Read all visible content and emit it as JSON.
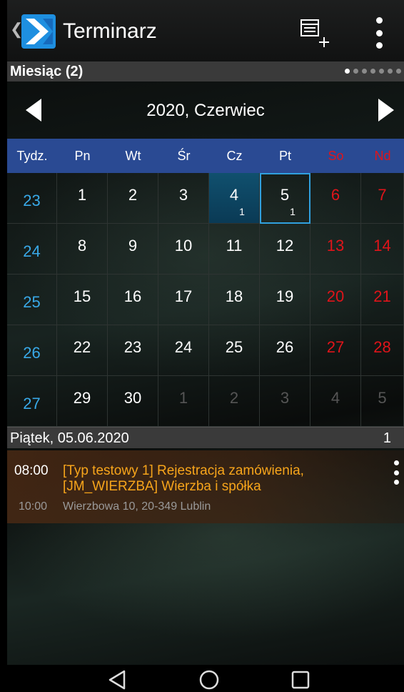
{
  "app": {
    "title": "Terminarz"
  },
  "subbar": {
    "title": "Miesiąc (2)",
    "pages": 7,
    "active_page": 0
  },
  "monthnav": {
    "label": "2020, Czerwiec"
  },
  "weekdays": {
    "week": "Tydz.",
    "d": [
      "Pn",
      "Wt",
      "Śr",
      "Cz",
      "Pt",
      "So",
      "Nd"
    ]
  },
  "colors": {
    "accent": "#39a9e8",
    "weekend": "#e0141a",
    "event": "#f7a51b",
    "header": "#2a4a93"
  },
  "calendar": {
    "weeks": [
      {
        "week": "23",
        "days": [
          {
            "n": "1",
            "other": false,
            "count": ""
          },
          {
            "n": "2",
            "other": false,
            "count": ""
          },
          {
            "n": "3",
            "other": false,
            "count": ""
          },
          {
            "n": "4",
            "other": false,
            "count": "1",
            "today": true
          },
          {
            "n": "5",
            "other": false,
            "count": "1",
            "selected": true
          },
          {
            "n": "6",
            "other": false,
            "count": ""
          },
          {
            "n": "7",
            "other": false,
            "count": ""
          }
        ]
      },
      {
        "week": "24",
        "days": [
          {
            "n": "8",
            "other": false,
            "count": ""
          },
          {
            "n": "9",
            "other": false,
            "count": ""
          },
          {
            "n": "10",
            "other": false,
            "count": ""
          },
          {
            "n": "11",
            "other": false,
            "count": ""
          },
          {
            "n": "12",
            "other": false,
            "count": ""
          },
          {
            "n": "13",
            "other": false,
            "count": ""
          },
          {
            "n": "14",
            "other": false,
            "count": ""
          }
        ]
      },
      {
        "week": "25",
        "days": [
          {
            "n": "15",
            "other": false,
            "count": ""
          },
          {
            "n": "16",
            "other": false,
            "count": ""
          },
          {
            "n": "17",
            "other": false,
            "count": ""
          },
          {
            "n": "18",
            "other": false,
            "count": ""
          },
          {
            "n": "19",
            "other": false,
            "count": ""
          },
          {
            "n": "20",
            "other": false,
            "count": ""
          },
          {
            "n": "21",
            "other": false,
            "count": ""
          }
        ]
      },
      {
        "week": "26",
        "days": [
          {
            "n": "22",
            "other": false,
            "count": ""
          },
          {
            "n": "23",
            "other": false,
            "count": ""
          },
          {
            "n": "24",
            "other": false,
            "count": ""
          },
          {
            "n": "25",
            "other": false,
            "count": ""
          },
          {
            "n": "26",
            "other": false,
            "count": ""
          },
          {
            "n": "27",
            "other": false,
            "count": ""
          },
          {
            "n": "28",
            "other": false,
            "count": ""
          }
        ]
      },
      {
        "week": "27",
        "days": [
          {
            "n": "29",
            "other": false,
            "count": ""
          },
          {
            "n": "30",
            "other": false,
            "count": ""
          },
          {
            "n": "1",
            "other": true,
            "count": ""
          },
          {
            "n": "2",
            "other": true,
            "count": ""
          },
          {
            "n": "3",
            "other": true,
            "count": ""
          },
          {
            "n": "4",
            "other": true,
            "count": ""
          },
          {
            "n": "5",
            "other": true,
            "count": ""
          }
        ]
      }
    ]
  },
  "day": {
    "title": "Piątek, 05.06.2020",
    "count": "1"
  },
  "event": {
    "start": "08:00",
    "title": "[Typ testowy 1] Rejestracja zamówienia, [JM_WIERZBA] Wierzba i spółka",
    "end": "10:00",
    "location": "Wierzbowa 10, 20-349 Lublin"
  }
}
